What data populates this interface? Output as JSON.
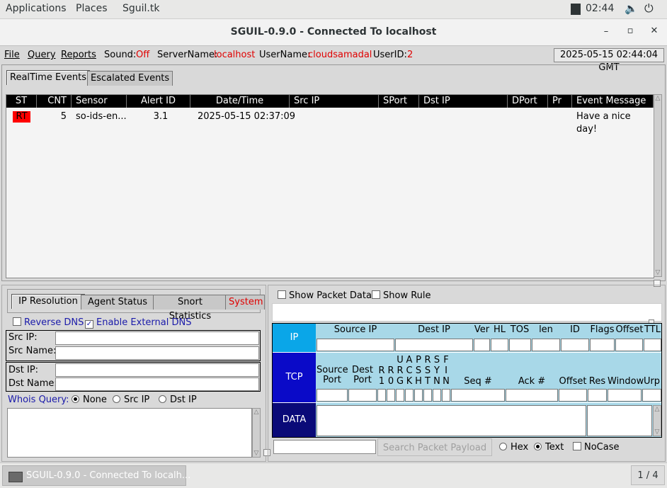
{
  "topbar": {
    "applications": "Applications",
    "places": "Places",
    "app": "Sguil.tk",
    "time": "02:44"
  },
  "window": {
    "title": "SGUIL-0.9.0 - Connected To localhost"
  },
  "menubar": {
    "file": "File",
    "query": "Query",
    "reports": "Reports",
    "sound_label": "Sound:",
    "sound_value": "Off",
    "server_label": "ServerName:",
    "server_value": "localhost",
    "user_label": "UserName:",
    "user_value": "cloudsamadal",
    "userid_label": "UserID:",
    "userid_value": "2",
    "clock": "2025-05-15 02:44:04 GMT"
  },
  "tabs": [
    "RealTime Events",
    "Escalated Events"
  ],
  "events": {
    "columns": [
      "ST",
      "CNT",
      "Sensor",
      "Alert ID",
      "Date/Time",
      "Src IP",
      "SPort",
      "Dst IP",
      "DPort",
      "Pr",
      "Event Message"
    ],
    "rows": [
      {
        "st": "RT",
        "cnt": "5",
        "sensor": "so-ids-en...",
        "alert_id": "3.1",
        "datetime": "2025-05-15 02:37:09",
        "src_ip": "",
        "sport": "",
        "dst_ip": "",
        "dport": "",
        "pr": "",
        "message": "Have a nice day!"
      }
    ]
  },
  "lower_tabs": [
    "IP Resolution",
    "Agent Status",
    "Snort Statistics",
    "System"
  ],
  "ipres": {
    "reverse_dns": "Reverse DNS",
    "external_dns": "Enable External DNS",
    "src_ip": "Src IP:",
    "src_name": "Src Name:",
    "dst_ip": "Dst IP:",
    "dst_name": "Dst Name:",
    "whois": "Whois Query:",
    "opt_none": "None",
    "opt_src": "Src IP",
    "opt_dst": "Dst IP"
  },
  "packet": {
    "show_packet": "Show Packet Data",
    "show_rule": "Show Rule",
    "ip_band": "IP",
    "tcp_band": "TCP",
    "data_band": "DATA",
    "ip_headers": [
      "Source IP",
      "Dest IP",
      "Ver",
      "HL",
      "TOS",
      "len",
      "ID",
      "Flags",
      "Offset",
      "TTL"
    ],
    "tcp_src_port": [
      "Source",
      "Port"
    ],
    "tcp_dst_port": [
      "Dest",
      "Port"
    ],
    "tcp_flags_top": [
      "U",
      "A",
      "P",
      "R",
      "S",
      "F"
    ],
    "tcp_flags_mid": [
      "R",
      "R",
      "R",
      "C",
      "S",
      "S",
      "Y",
      "I"
    ],
    "tcp_flags_bot": [
      "1",
      "0",
      "G",
      "K",
      "H",
      "T",
      "N",
      "N"
    ],
    "tcp_headers": [
      "Seq #",
      "Ack #",
      "Offset",
      "Res",
      "Window",
      "Urp"
    ],
    "search_button": "Search Packet Payload",
    "hex": "Hex",
    "text": "Text",
    "nocase": "NoCase"
  },
  "taskbar": {
    "task": "SGUIL-0.9.0 - Connected To localh...",
    "workspace": "1 / 4"
  },
  "colors": {
    "rt_badge": "#ff0000",
    "ip_band": "#0aa6e8",
    "tcp_band": "#0a0ac8",
    "data_band": "#0a0a78",
    "light_row": "#a8d8e8"
  }
}
